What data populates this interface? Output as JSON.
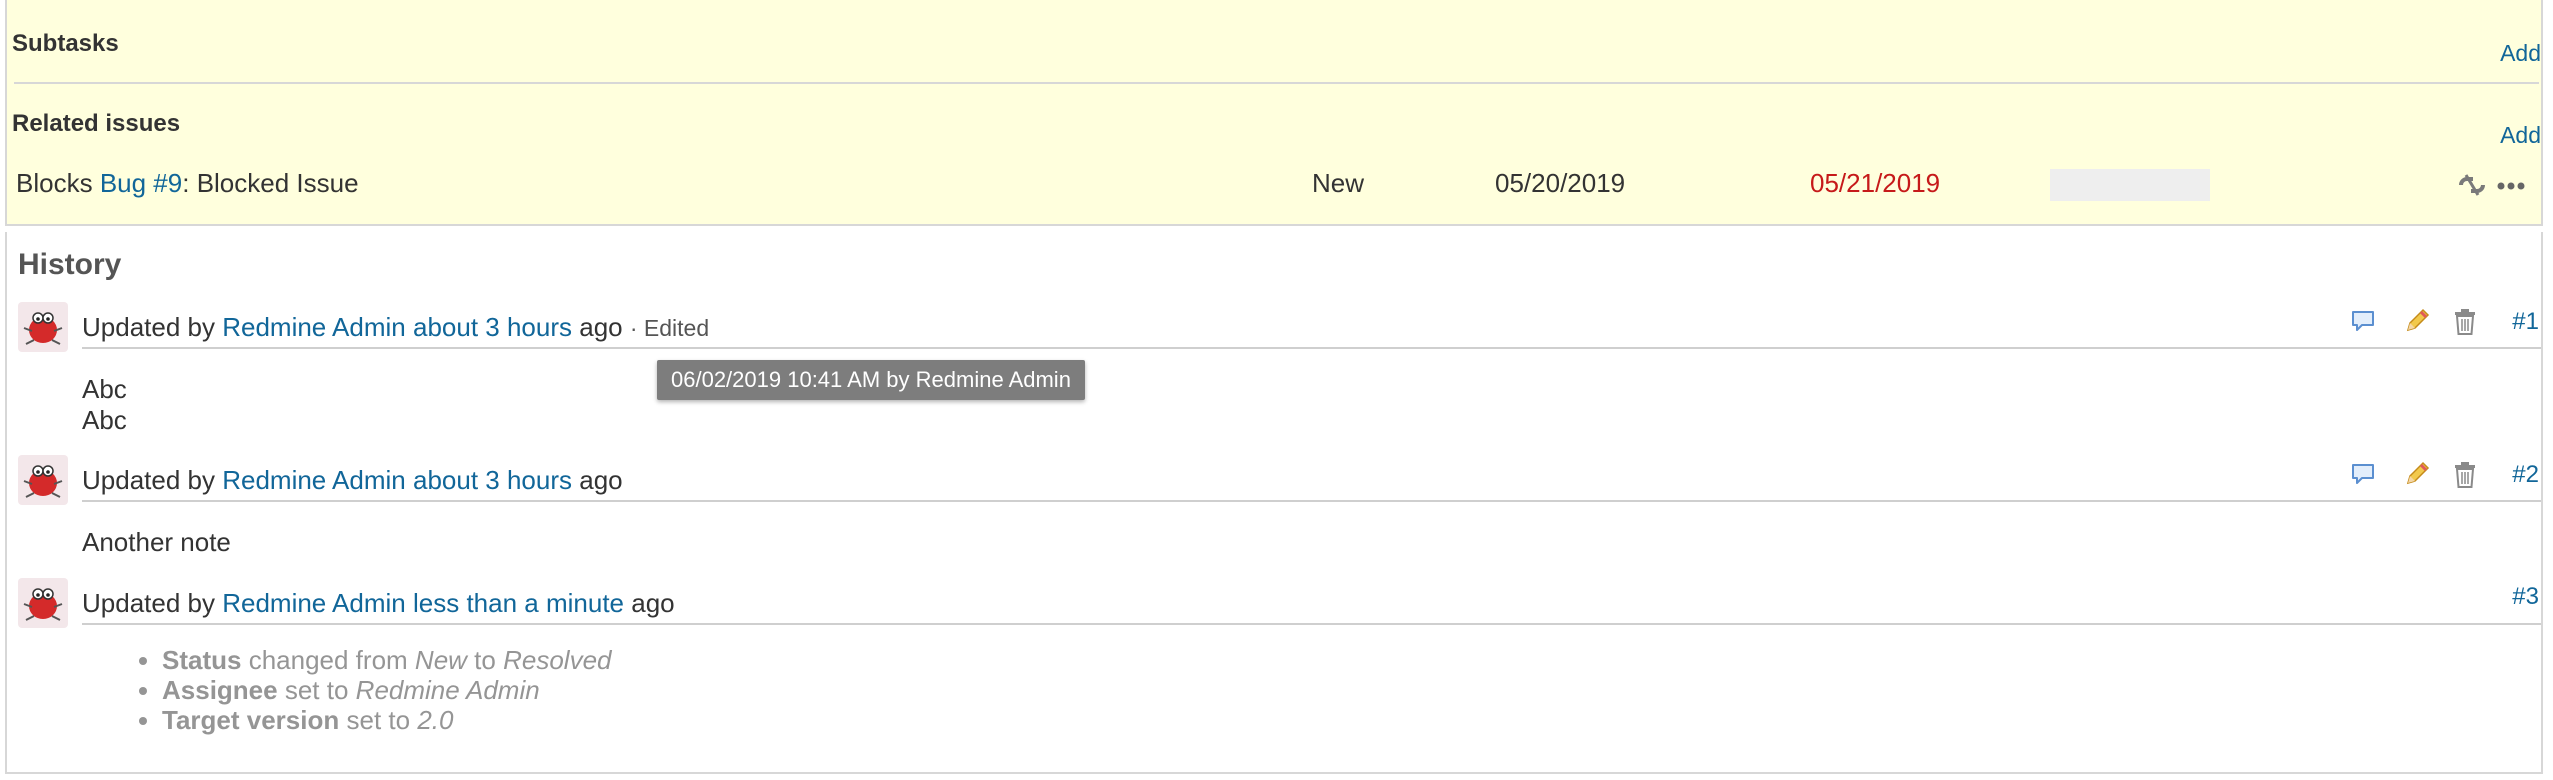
{
  "subtasks": {
    "title": "Subtasks",
    "add_label": "Add"
  },
  "related": {
    "title": "Related issues",
    "add_label": "Add",
    "row": {
      "relation": "Blocks",
      "issue_link": "Bug #9",
      "separator": ":",
      "subject": "Blocked Issue",
      "status": "New",
      "start_date": "05/20/2019",
      "due_date": "05/21/2019",
      "due_color": "#c61a1a",
      "progress": 0,
      "icons": [
        "unlink-icon",
        "more-icon"
      ]
    }
  },
  "history": {
    "title": "History",
    "journals": [
      {
        "prefix": "Updated by",
        "author": "Redmine Admin",
        "time": "about 3 hours",
        "suffix": "ago",
        "edited": "· Edited",
        "number": "#1",
        "notes": [
          "Abc",
          "Abc"
        ]
      },
      {
        "prefix": "Updated by",
        "author": "Redmine Admin",
        "time": "about 3 hours",
        "suffix": "ago",
        "number": "#2",
        "notes": [
          "Another note"
        ]
      },
      {
        "prefix": "Updated by",
        "author": "Redmine Admin",
        "time": "less than a minute",
        "suffix": "ago",
        "number": "#3",
        "details": [
          {
            "field": "Status",
            "text1": "changed from",
            "old": "New",
            "text2": "to",
            "new": "Resolved"
          },
          {
            "field": "Assignee",
            "text1": "set to",
            "new": "Redmine Admin"
          },
          {
            "field": "Target version",
            "text1": "set to",
            "new": "2.0"
          }
        ]
      }
    ],
    "tooltip": "06/02/2019 10:41 AM by Redmine Admin"
  },
  "colors": {
    "link": "#116699",
    "box_bg": "#ffffdd",
    "border": "#d7d7d7",
    "overdue": "#c61a1a"
  },
  "icons": [
    "avatar-icon",
    "quote-icon",
    "edit-icon",
    "delete-icon"
  ]
}
